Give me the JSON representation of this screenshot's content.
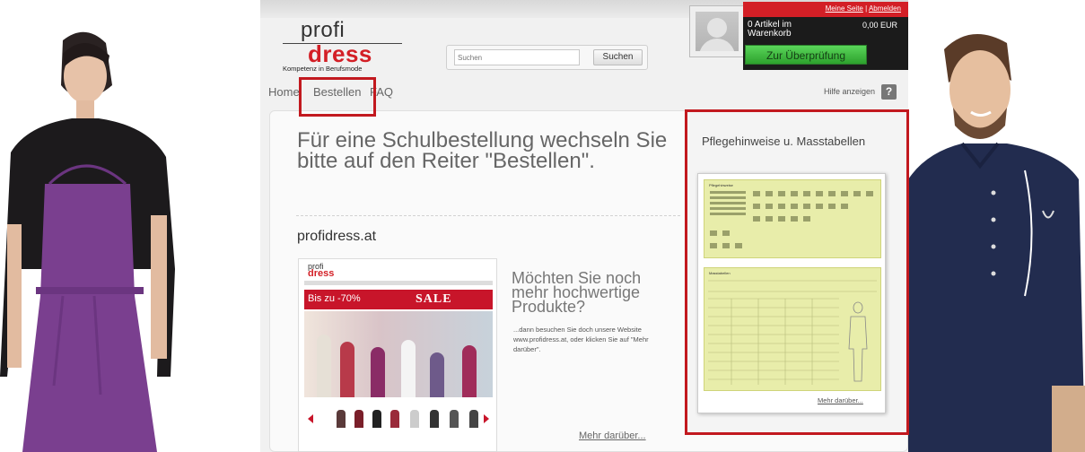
{
  "logo": {
    "profi": "profi",
    "dress": "dress",
    "tagline": "Kompetenz in Berufsmode"
  },
  "search": {
    "placeholder": "Suchen",
    "button": "Suchen"
  },
  "cart": {
    "my_page": "Meine Seite",
    "separator": "|",
    "logout": "Abmelden",
    "count": "0 Artikel im Warenkorb",
    "total": "0,00 EUR",
    "checkout_button": "Zur Überprüfung"
  },
  "nav": {
    "items": [
      "Home",
      "Bestellen",
      "FAQ"
    ]
  },
  "help": {
    "label": "Hilfe anzeigen",
    "icon_glyph": "?"
  },
  "main": {
    "headline": "Für eine Schulbestellung wechseln Sie bitte auf den Reiter \"Bestellen\".",
    "site_name": "profidress.at",
    "preview": {
      "logo_profi": "profi",
      "logo_dress": "dress",
      "sale_left": "Bis zu -70%",
      "sale_right": "SALE"
    },
    "promo_title": "Möchten Sie noch mehr hochwertige Produkte?",
    "promo_text": "...dann besuchen Sie doch unsere Website www.profidress.at, oder klicken Sie auf \"Mehr darüber\".",
    "more_link": "Mehr darüber..."
  },
  "sidebar": {
    "title": "Pflegehinweise u. Masstabellen",
    "doc_top_title": "Pflegehinweise",
    "doc_bottom_title": "Masstabellen",
    "more_link": "Mehr darüber..."
  },
  "colors": {
    "brand_red": "#d31f26",
    "highlight_red": "#c2191f",
    "cart_green": "#3cb93c",
    "doc_yellow": "#e8edaa"
  }
}
